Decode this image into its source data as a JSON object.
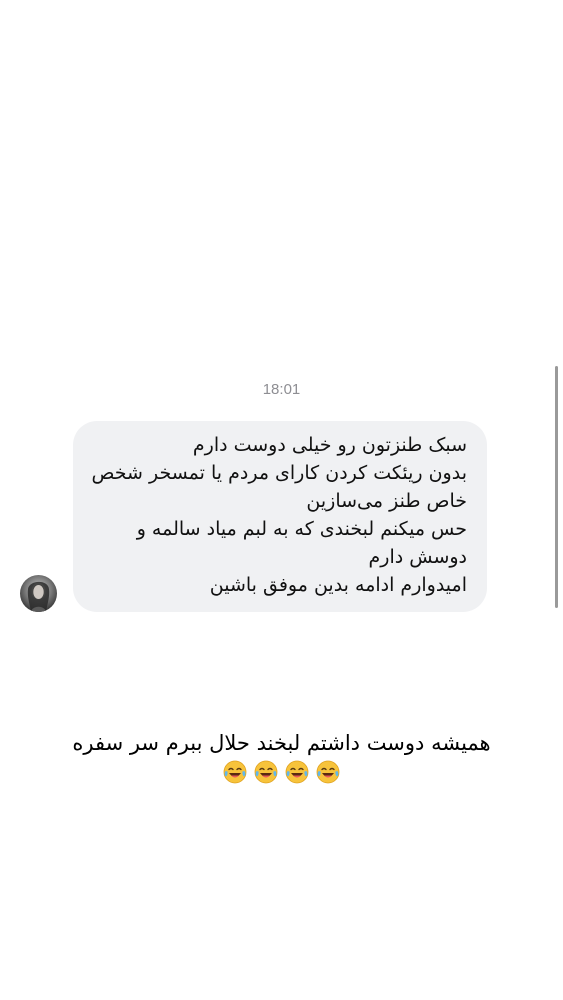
{
  "chat": {
    "timestamp": "18:01",
    "message": {
      "lines": [
        "سبک طنزتون رو خیلی دوست دارم",
        "بدون ریئکت کردن کارای مردم یا تمسخر شخص",
        "خاص طنز می‌سازین",
        "حس میکنم لبخندی که به لبم میاد سالمه و",
        "دوسش دارم",
        "امیدوارم ادامه بدین موفق باشین"
      ]
    },
    "avatar": {
      "icon": "profile-photo-avatar"
    }
  },
  "caption": {
    "text": "همیشه دوست داشتم لبخند حلال ببرم سر سفره",
    "emojis": [
      "😂",
      "😂",
      "😂",
      "😂"
    ]
  },
  "colors": {
    "bubble_background": "#f0f1f3",
    "timestamp_text": "#8e8e93",
    "scrollbar": "#9a9a9a"
  }
}
